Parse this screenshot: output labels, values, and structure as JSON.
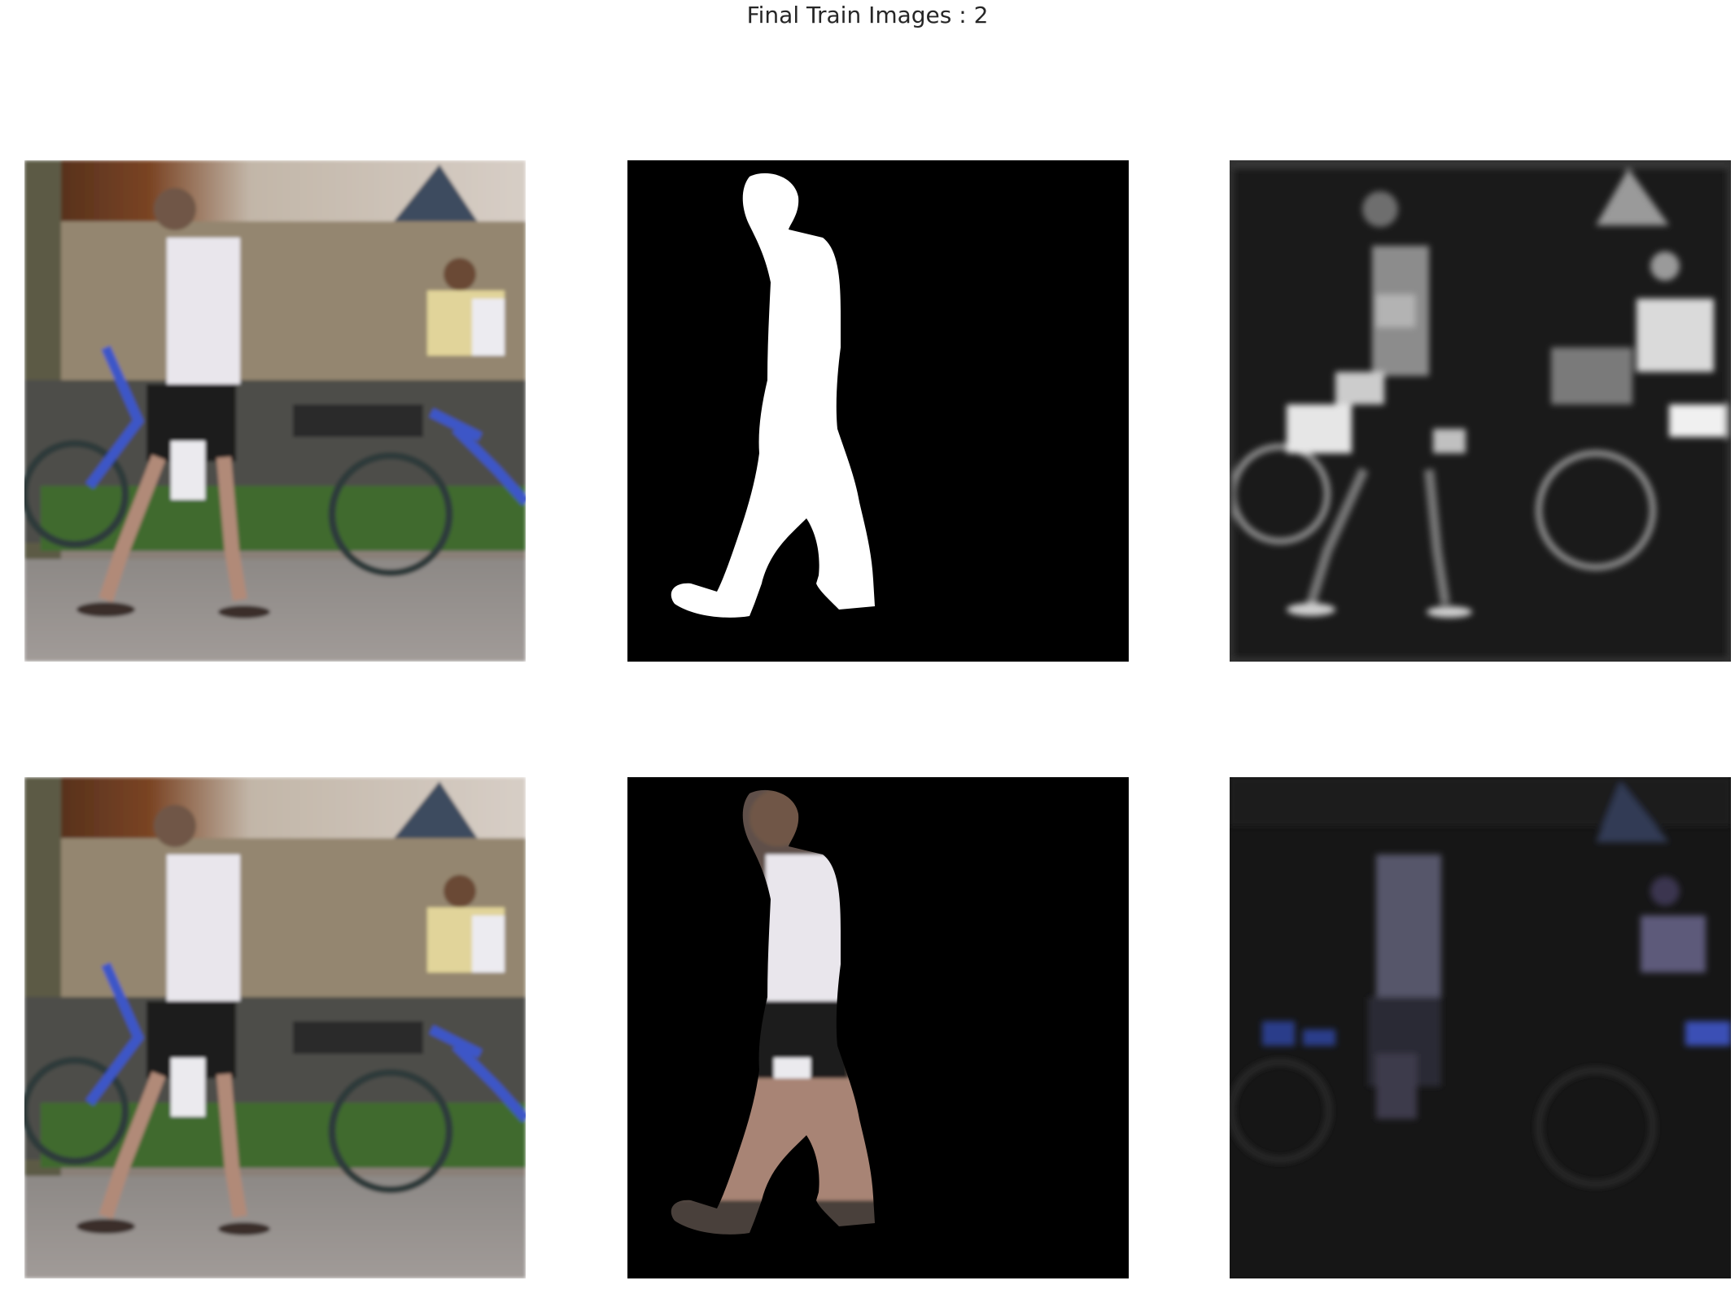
{
  "figure": {
    "title": "Final Train Images : 2"
  },
  "panels": [
    {
      "id": "r1c1",
      "content": "original-photo"
    },
    {
      "id": "r1c2",
      "content": "binary-mask"
    },
    {
      "id": "r1c3",
      "content": "grayscale-feature-map"
    },
    {
      "id": "r2c1",
      "content": "original-photo"
    },
    {
      "id": "r2c2",
      "content": "masked-person"
    },
    {
      "id": "r2c3",
      "content": "dark-color-feature-map"
    }
  ]
}
